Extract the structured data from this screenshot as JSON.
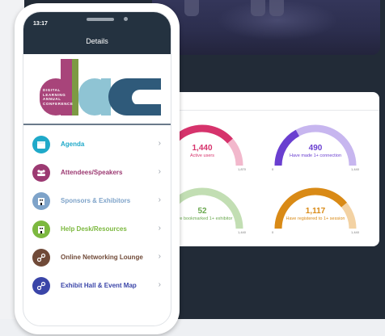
{
  "phone": {
    "status_time": "13:17",
    "header_title": "Details",
    "logo_words": [
      "DIGITAL",
      "LEARNING",
      "ANNUAL",
      "CONFERENCE"
    ],
    "menu": [
      {
        "label": "Agenda",
        "icon": "calendar-icon",
        "color": "#1fa9c9"
      },
      {
        "label": "Attendees/Speakers",
        "icon": "people-icon",
        "color": "#9c3a72"
      },
      {
        "label": "Sponsors & Exhibitors",
        "icon": "building-icon",
        "color": "#7ea3c9"
      },
      {
        "label": "Help Desk/Resources",
        "icon": "building-icon",
        "color": "#7cb83f"
      },
      {
        "label": "Online Networking Lounge",
        "icon": "link-icon",
        "color": "#704a38"
      },
      {
        "label": "Exhibit Hall & Event Map",
        "icon": "link-icon",
        "color": "#3a45a8"
      }
    ]
  },
  "stats": {
    "gauges": [
      {
        "value": "1,440",
        "caption": "Active users",
        "min": "0",
        "max": "1,870",
        "fraction": 0.77,
        "color": "#d6336c",
        "track": "#f2b8cc"
      },
      {
        "value": "490",
        "caption": "Have made 1+ connection",
        "min": "0",
        "max": "1,440",
        "fraction": 0.34,
        "color": "#6a3fd0",
        "track": "#c7b6ef"
      },
      {
        "value": "52",
        "caption": "Have bookmarked 1+ exhibitor",
        "min": "0",
        "max": "1,440",
        "fraction": 0.04,
        "color": "#6aa84f",
        "track": "#c2deb3"
      },
      {
        "value": "1,117",
        "caption": "Have registered to 1+ session",
        "min": "0",
        "max": "1,440",
        "fraction": 0.78,
        "color": "#d98a16",
        "track": "#f3d2a3"
      }
    ]
  }
}
